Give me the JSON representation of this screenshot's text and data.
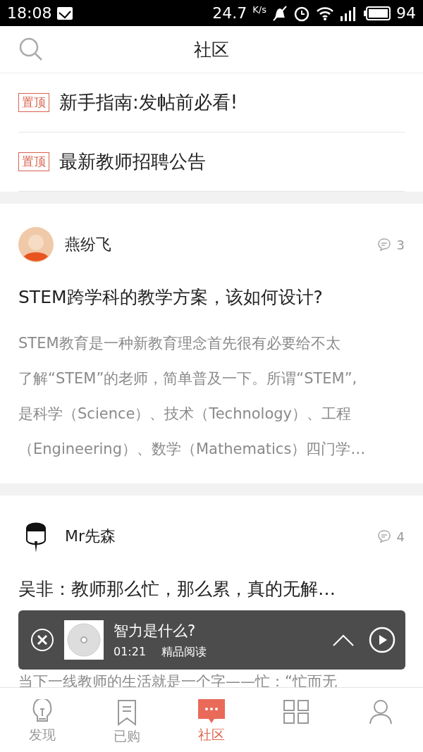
{
  "status_bar": {
    "time": "18:08",
    "speed": "24.7",
    "speed_unit": "K/s",
    "battery": "94"
  },
  "header": {
    "title": "社区"
  },
  "pinned": [
    {
      "tag": "置顶",
      "title": "新手指南:发帖前必看!"
    },
    {
      "tag": "置顶",
      "title": "最新教师招聘公告"
    }
  ],
  "posts": [
    {
      "author": "燕纷飞",
      "kind": "photo",
      "comments": "3",
      "title": "STEM跨学科的教学方案，该如何设计?",
      "body": [
        "STEM教育是一种新教育理念首先很有必要给不太",
        "了解“STEM”的老师，简单普及一下。所谓“STEM”,",
        "是科学（Science）、技术（Technology）、工程",
        "（Engineering）、数学（Mathematics）四门学…"
      ]
    },
    {
      "author": "Mr先森",
      "kind": "sketch",
      "comments": "4",
      "title": "吴非：教师那么忙，那么累，真的无解…",
      "body": [
        "当下一线教师的生活就是一个字——忙：“忙而无"
      ]
    }
  ],
  "player": {
    "title": "智力是什么?",
    "time": "01:21",
    "category": "精品阅读"
  },
  "tab_bar": [
    {
      "kind": "bulb",
      "label": "发现",
      "selected": false
    },
    {
      "kind": "bookmark",
      "label": "已购",
      "selected": false
    },
    {
      "kind": "chat",
      "label": "社区",
      "selected": true
    },
    {
      "kind": "grid",
      "selected": false
    },
    {
      "kind": "person",
      "selected": false
    }
  ]
}
